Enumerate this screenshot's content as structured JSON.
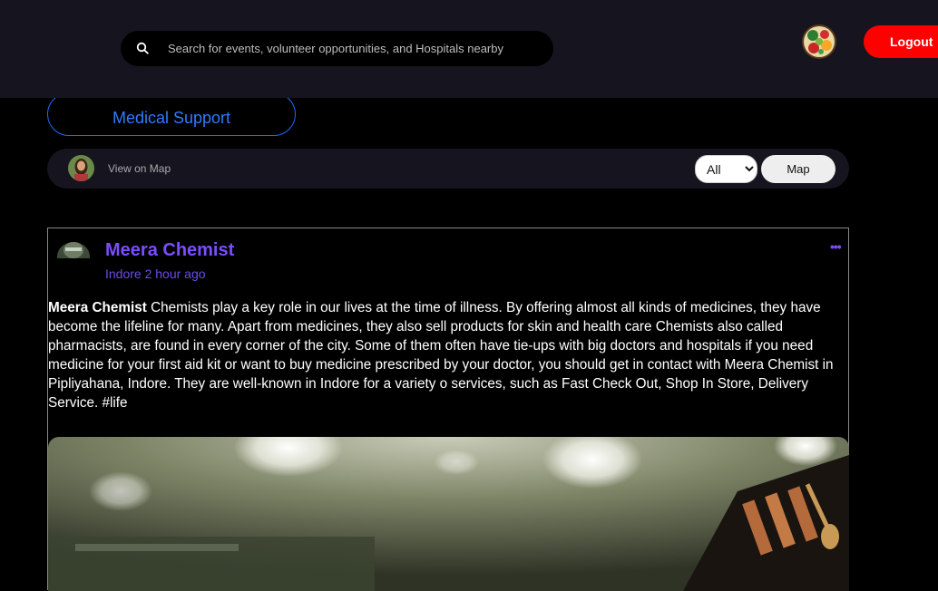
{
  "header": {
    "search": {
      "placeholder": "Search for events, volunteer opportunities, and Hospitals nearby",
      "icon": "search-icon"
    },
    "logout_label": "Logout",
    "colors": {
      "bar": "#16151f",
      "logout": "#ff0000"
    }
  },
  "category": {
    "label": "Medical Support",
    "color": "#2f7bff"
  },
  "map_bar": {
    "view_on_map_label": "View on Map",
    "filter_selected": "All",
    "map_button_label": "Map"
  },
  "post": {
    "author": "Meera Chemist",
    "location": "Indore",
    "time": "2 hour ago",
    "more_icon": "more-dots-icon",
    "body_bold": "Meera Chemist",
    "body_text": " Chemists play a key role in our lives at the time of illness. By offering almost all kinds of medicines, they have become the lifeline for many. Apart from medicines, they also sell products for skin and health care Chemists also called pharmacists, are found in every corner of the city. Some of them often have tie-ups with big doctors and hospitals if you need medicine for your first aid kit or want to buy medicine prescribed by your doctor, you should get in contact with Meera Chemist in Pipliyahana, Indore. They are well-known in Indore for a variety o services, such as Fast Check Out, Shop In Store, Delivery Service. #life",
    "accent_color": "#7b4dff"
  }
}
